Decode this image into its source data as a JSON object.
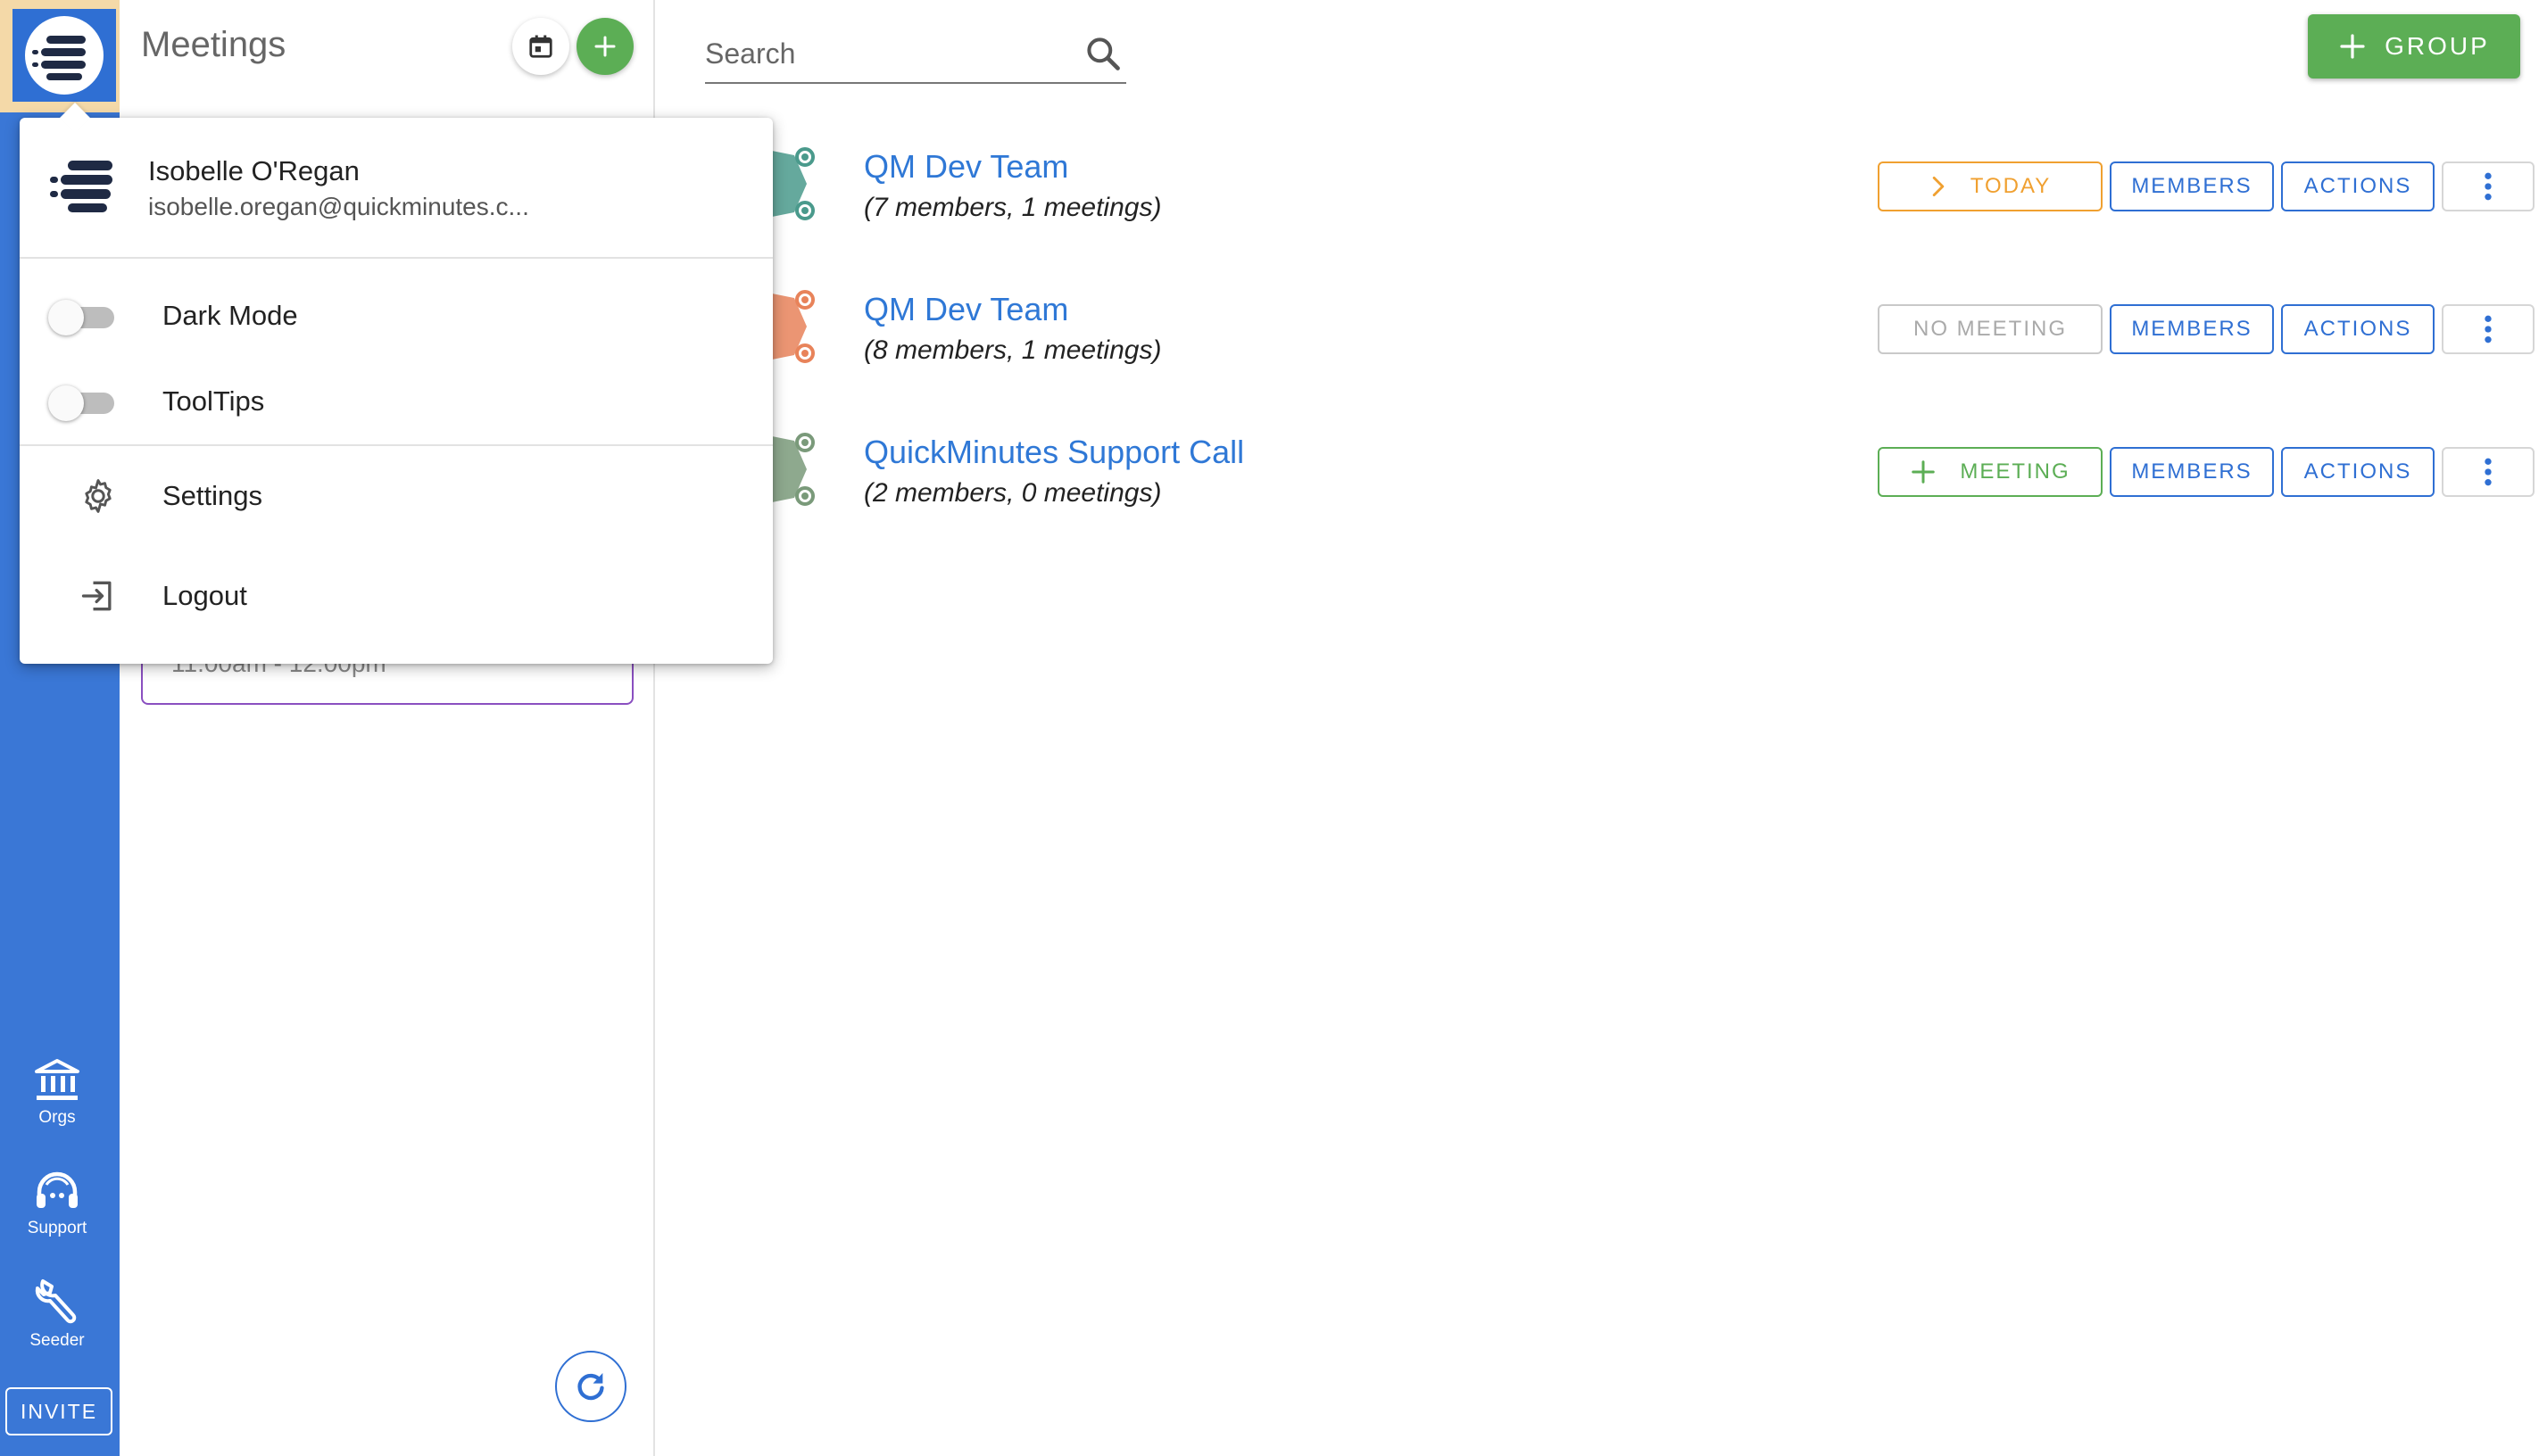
{
  "sidebar": {
    "items": [
      {
        "label": "Orgs",
        "icon": "bank-icon"
      },
      {
        "label": "Support",
        "icon": "headset-icon"
      },
      {
        "label": "Seeder",
        "icon": "wrench-icon"
      }
    ],
    "invite_label": "INVITE"
  },
  "meetings_panel": {
    "title": "Meetings",
    "card_time": "11:00am - 12:00pm"
  },
  "search": {
    "placeholder": "Search"
  },
  "header": {
    "group_button": "GROUP"
  },
  "groups": [
    {
      "name": "QM Dev Team",
      "subtitle": "(7 members, 1 meetings)",
      "status_label": "TODAY",
      "status_type": "today",
      "avatar_color": "#4a9a8c"
    },
    {
      "name": "QM Dev Team",
      "subtitle": "(8 members, 1 meetings)",
      "status_label": "NO MEETING",
      "status_type": "none",
      "avatar_color": "#e8835a"
    },
    {
      "name": "QuickMinutes Support Call",
      "subtitle": "(2 members, 0 meetings)",
      "status_label": "MEETING",
      "status_type": "add",
      "avatar_color": "#7a9a7a"
    }
  ],
  "group_buttons": {
    "members": "MEMBERS",
    "actions": "ACTIONS"
  },
  "profile_menu": {
    "user_name": "Isobelle O'Regan",
    "user_email": "isobelle.oregan@quickminutes.c...",
    "dark_mode_label": "Dark Mode",
    "dark_mode_on": false,
    "tooltips_label": "ToolTips",
    "tooltips_on": false,
    "settings_label": "Settings",
    "logout_label": "Logout"
  },
  "colors": {
    "rail": "#3a77d6",
    "primary": "#2f6fd3",
    "green": "#5cae55",
    "orange": "#f0a030",
    "link": "#2f78d6"
  }
}
